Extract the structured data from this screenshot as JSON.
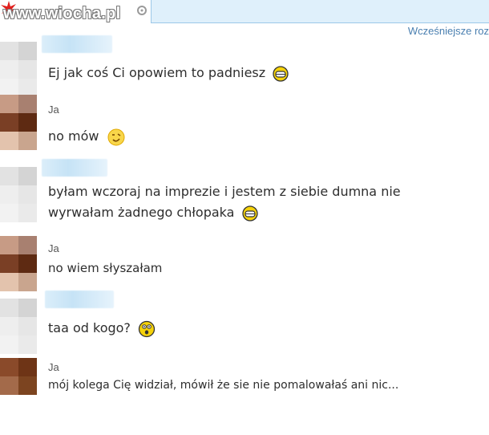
{
  "watermark": "www.wiocha.pl",
  "header": {
    "earlier_link": "Wcześniejsze roz"
  },
  "messages": [
    {
      "sender": "",
      "text": "Ej jak coś Ci opowiem to padniesz",
      "emoticon": "grin-icon"
    },
    {
      "sender": "Ja",
      "text": "no mów",
      "emoticon": "wink-smile-icon"
    },
    {
      "sender": "",
      "text": "byłam wczoraj na imprezie i jestem z siebie dumna nie",
      "text2": "wyrwałam żadnego chłopaka",
      "emoticon": "grin-icon"
    },
    {
      "sender": "Ja",
      "text": "no wiem słyszałam",
      "emoticon": ""
    },
    {
      "sender": "",
      "text": "taa od kogo?",
      "emoticon": "surprised-icon"
    },
    {
      "sender": "Ja",
      "text": "mój kolega Cię widział, mówił że sie nie pomalowałaś ani nic...",
      "emoticon": ""
    }
  ],
  "colors": {
    "accent": "#4a7fb0",
    "input_bg": "#dff0fb",
    "input_border": "#9dc8e8",
    "emoticon_yellow": "#f5d20a"
  }
}
